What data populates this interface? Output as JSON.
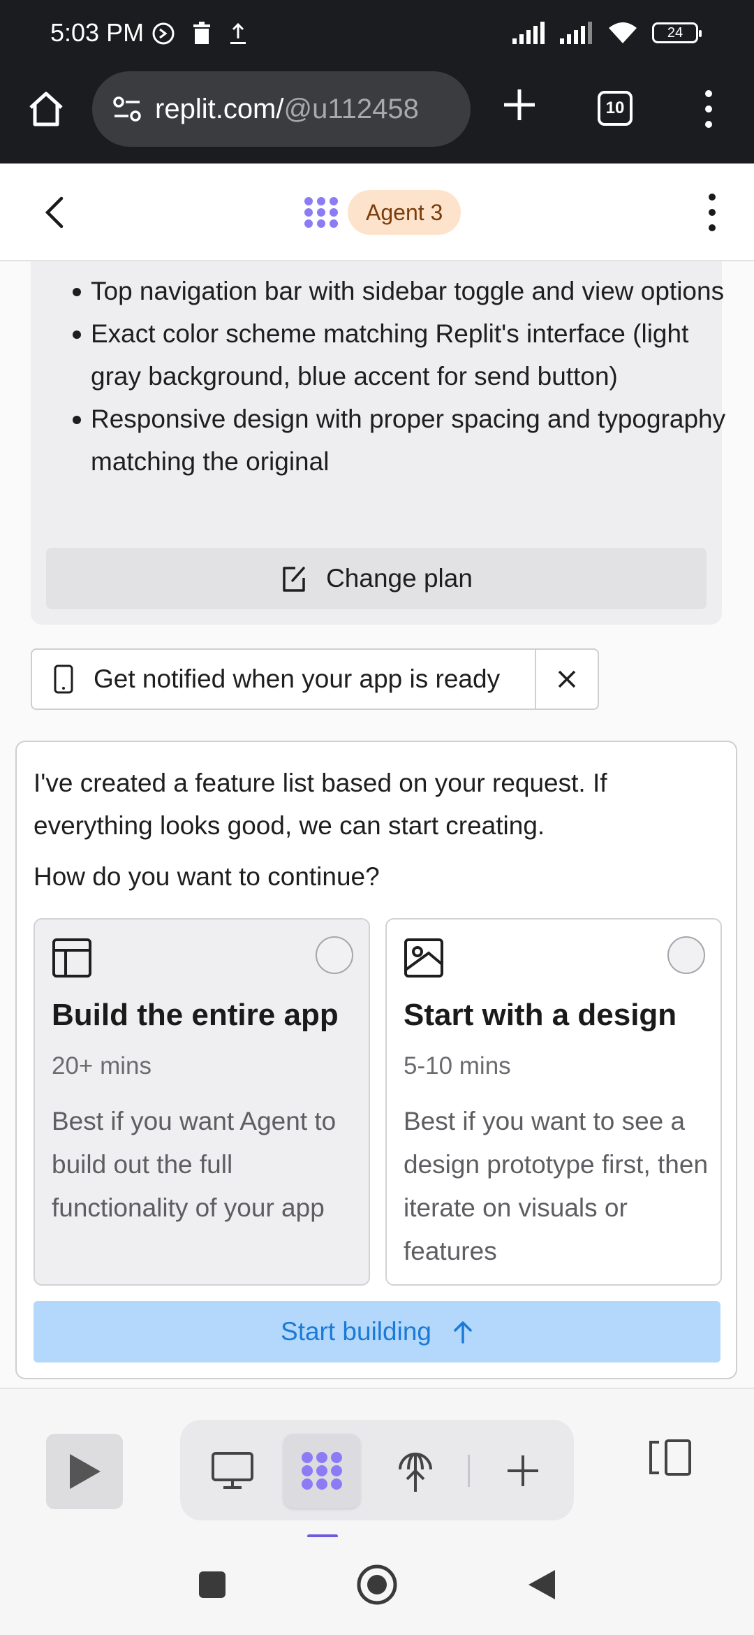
{
  "status_bar": {
    "time": "5:03 PM",
    "battery": "24",
    "icons": [
      "whatsapp-icon",
      "trash-icon",
      "upload-icon",
      "signal-icon",
      "signal-icon",
      "wifi-icon",
      "battery-icon"
    ]
  },
  "browser": {
    "url_host": "replit.com/",
    "url_path": "@u112458",
    "tab_count": "10"
  },
  "header": {
    "agent_badge": "Agent 3",
    "accent": "#8b7cf6"
  },
  "plan": {
    "items": [
      "Top navigation bar with sidebar toggle and view options",
      "Exact color scheme matching Replit's interface (light gray background, blue accent for send button)",
      "Responsive design with proper spacing and typography matching the original"
    ],
    "change_plan_label": "Change plan"
  },
  "notify": {
    "text": "Get notified when your app is ready"
  },
  "question": {
    "message": "I've created a feature list based on your request. If everything looks good, we can start creating.",
    "ask": "How do you want to continue?",
    "options": [
      {
        "title": "Build the entire app",
        "time": "20+ mins",
        "description": "Best if you want Agent to build out the full functionality of your app",
        "icon": "layout-icon"
      },
      {
        "title": "Start with a design",
        "time": "5-10 mins",
        "description": "Best if you want to see a design prototype first, then iterate on visuals or features",
        "icon": "image-icon"
      }
    ],
    "start_label": "Start building",
    "start_color": "#b3d8fb"
  }
}
